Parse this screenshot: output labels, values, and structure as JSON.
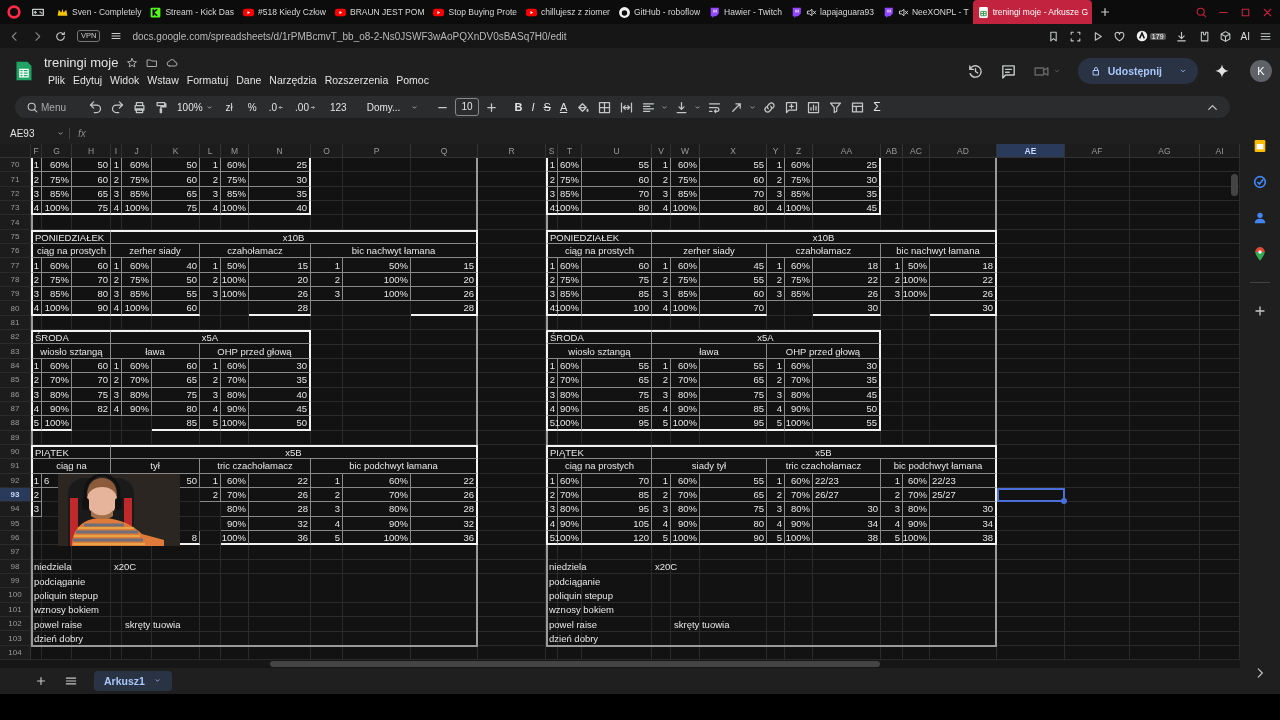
{
  "browser": {
    "tabs": [
      {
        "kind": "crown",
        "title": "Sven - Completely",
        "muted": false,
        "selected": false
      },
      {
        "kind": "kick",
        "title": "Stream - Kick Das",
        "muted": false,
        "selected": false
      },
      {
        "kind": "video",
        "title": "#518 Kiedy Człow",
        "muted": false,
        "selected": false
      },
      {
        "kind": "video",
        "title": "BRAUN JEST POM",
        "muted": false,
        "selected": false
      },
      {
        "kind": "video",
        "title": "Stop Buying Prote",
        "muted": false,
        "selected": false
      },
      {
        "kind": "video",
        "title": "chillujesz z ziomer",
        "muted": false,
        "selected": false
      },
      {
        "kind": "github",
        "title": "GitHub - roboflow",
        "muted": false,
        "selected": false
      },
      {
        "kind": "twitch",
        "title": "Hawier - Twitch",
        "muted": false,
        "selected": false
      },
      {
        "kind": "twitch",
        "title": "lapajaguara93",
        "muted": true,
        "selected": false
      },
      {
        "kind": "twitch",
        "title": "NeeXONPL - T",
        "muted": true,
        "selected": false
      },
      {
        "kind": "sheets",
        "title": "treningi moje - Arkusze G",
        "muted": false,
        "selected": true
      }
    ],
    "vpn_badge": "VPN",
    "url": "docs.google.com/spreadsheets/d/1rPMBcmvT_bb_o8-2-Ns0JSWF3wAoPQXnDV0sBASq7H0/edit",
    "extension_badge": "179",
    "ai_label": "AI"
  },
  "docs": {
    "title": "treningi moje",
    "menu": [
      "Plik",
      "Edytuj",
      "Widok",
      "Wstaw",
      "Formatuj",
      "Dane",
      "Narzędzia",
      "Rozszerzenia",
      "Pomoc"
    ],
    "share": "Udostępnij",
    "avatar": "K"
  },
  "toolbar": [
    {
      "kind": "search",
      "label": "Menu"
    },
    {
      "kind": "undo"
    },
    {
      "kind": "redo"
    },
    {
      "kind": "print"
    },
    {
      "kind": "paint-format"
    },
    {
      "kind": "zoom",
      "label": "100%"
    },
    {
      "kind": "text",
      "label": "zł"
    },
    {
      "kind": "text",
      "label": "%"
    },
    {
      "kind": "decimals-less",
      "label": ".0"
    },
    {
      "kind": "decimals-more",
      "label": ".00"
    },
    {
      "kind": "text",
      "label": "123"
    },
    {
      "kind": "font",
      "label": "Domy..."
    },
    {
      "kind": "minus"
    },
    {
      "kind": "size",
      "label": "10"
    },
    {
      "kind": "plus"
    },
    {
      "kind": "bold",
      "label": "B"
    },
    {
      "kind": "italic",
      "label": "I"
    },
    {
      "kind": "strike",
      "label": "S"
    },
    {
      "kind": "text-color",
      "label": "A"
    },
    {
      "kind": "fill"
    },
    {
      "kind": "borders"
    },
    {
      "kind": "merge"
    },
    {
      "kind": "align"
    },
    {
      "kind": "valign"
    },
    {
      "kind": "wrap"
    },
    {
      "kind": "rotate"
    },
    {
      "kind": "link"
    },
    {
      "kind": "comment"
    },
    {
      "kind": "chart"
    },
    {
      "kind": "filter"
    },
    {
      "kind": "views"
    },
    {
      "kind": "sigma",
      "label": "Σ"
    },
    {
      "kind": "collapse"
    }
  ],
  "formula_bar": {
    "cell": "AE93",
    "fx": "fx"
  },
  "sheet": {
    "columns": [
      {
        "label": "F",
        "selected": false
      },
      {
        "label": "G",
        "selected": false
      },
      {
        "label": "H",
        "selected": false
      },
      {
        "label": "I",
        "selected": false
      },
      {
        "label": "J",
        "selected": false
      },
      {
        "label": "K",
        "selected": false
      },
      {
        "label": "L",
        "selected": false
      },
      {
        "label": "M",
        "selected": false
      },
      {
        "label": "N",
        "selected": false
      },
      {
        "label": "O",
        "selected": false
      },
      {
        "label": "P",
        "selected": false
      },
      {
        "label": "Q",
        "selected": false
      },
      {
        "label": "R",
        "selected": false
      },
      {
        "label": "S",
        "selected": false
      },
      {
        "label": "T",
        "selected": false
      },
      {
        "label": "U",
        "selected": false
      },
      {
        "label": "V",
        "selected": false
      },
      {
        "label": "W",
        "selected": false
      },
      {
        "label": "X",
        "selected": false
      },
      {
        "label": "Y",
        "selected": false
      },
      {
        "label": "Z",
        "selected": false
      },
      {
        "label": "AA",
        "selected": false
      },
      {
        "label": "AB",
        "selected": false
      },
      {
        "label": "AC",
        "selected": false
      },
      {
        "label": "AD",
        "selected": false
      },
      {
        "label": "AE",
        "selected": true
      },
      {
        "label": "AF",
        "selected": false
      },
      {
        "label": "AG",
        "selected": false
      },
      {
        "label": "AI",
        "selected": false
      }
    ],
    "rows": [
      {
        "label": "70",
        "selected": false
      },
      {
        "label": "71",
        "selected": false
      },
      {
        "label": "72",
        "selected": false
      },
      {
        "label": "73",
        "selected": false
      },
      {
        "label": "74",
        "selected": false
      },
      {
        "label": "75",
        "selected": false
      },
      {
        "label": "76",
        "selected": false
      },
      {
        "label": "77",
        "selected": false
      },
      {
        "label": "78",
        "selected": false
      },
      {
        "label": "79",
        "selected": false
      },
      {
        "label": "80",
        "selected": false
      },
      {
        "label": "81",
        "selected": false
      },
      {
        "label": "82",
        "selected": false
      },
      {
        "label": "83",
        "selected": false
      },
      {
        "label": "84",
        "selected": false
      },
      {
        "label": "85",
        "selected": false
      },
      {
        "label": "86",
        "selected": false
      },
      {
        "label": "87",
        "selected": false
      },
      {
        "label": "88",
        "selected": false
      },
      {
        "label": "89",
        "selected": false
      },
      {
        "label": "90",
        "selected": false
      },
      {
        "label": "91",
        "selected": false
      },
      {
        "label": "92",
        "selected": false
      },
      {
        "label": "93",
        "selected": true
      },
      {
        "label": "94",
        "selected": false
      },
      {
        "label": "95",
        "selected": false
      },
      {
        "label": "96",
        "selected": false
      },
      {
        "label": "97",
        "selected": false
      },
      {
        "label": "98",
        "selected": false
      },
      {
        "label": "99",
        "selected": false
      },
      {
        "label": "100",
        "selected": false
      },
      {
        "label": "101",
        "selected": false
      },
      {
        "label": "102",
        "selected": false
      },
      {
        "label": "103",
        "selected": false
      },
      {
        "label": "104",
        "selected": false
      }
    ],
    "weeks": [
      {
        "blocks": [
          {
            "exercises": [
              {
                "sets": [
                  {
                    "n": "1",
                    "pct": "60%",
                    "load": "50"
                  },
                  {
                    "n": "2",
                    "pct": "75%",
                    "load": "60"
                  },
                  {
                    "n": "3",
                    "pct": "85%",
                    "load": "65"
                  },
                  {
                    "n": "4",
                    "pct": "100%",
                    "load": "75"
                  }
                ]
              },
              {
                "sets": [
                  {
                    "n": "1",
                    "pct": "60%",
                    "load": "50"
                  },
                  {
                    "n": "2",
                    "pct": "75%",
                    "load": "60"
                  },
                  {
                    "n": "3",
                    "pct": "85%",
                    "load": "65"
                  },
                  {
                    "n": "4",
                    "pct": "100%",
                    "load": "75"
                  }
                ]
              },
              {
                "sets": [
                  {
                    "n": "1",
                    "pct": "60%",
                    "load": "25"
                  },
                  {
                    "n": "2",
                    "pct": "75%",
                    "load": "30"
                  },
                  {
                    "n": "3",
                    "pct": "85%",
                    "load": "35"
                  },
                  {
                    "n": "4",
                    "pct": "100%",
                    "load": "40"
                  }
                ]
              }
            ]
          },
          {
            "title": "PONIEDZIAŁEK",
            "label": "x10B",
            "exercises": [
              {
                "name": "ciąg na prostych",
                "sets": [
                  {
                    "n": "1",
                    "pct": "60%",
                    "load": "60"
                  },
                  {
                    "n": "2",
                    "pct": "75%",
                    "load": "70"
                  },
                  {
                    "n": "3",
                    "pct": "85%",
                    "load": "80"
                  },
                  {
                    "n": "4",
                    "pct": "100%",
                    "load": "90"
                  }
                ]
              },
              {
                "name": "zerher siady",
                "sets": [
                  {
                    "n": "1",
                    "pct": "60%",
                    "load": "40"
                  },
                  {
                    "n": "2",
                    "pct": "75%",
                    "load": "50"
                  },
                  {
                    "n": "3",
                    "pct": "85%",
                    "load": "55"
                  },
                  {
                    "n": "4",
                    "pct": "100%",
                    "load": "60"
                  }
                ]
              },
              {
                "name": "czahołamacz",
                "sets": [
                  {
                    "n": "1",
                    "pct": "50%",
                    "load": "15"
                  },
                  {
                    "n": "2",
                    "pct": "100%",
                    "load": "20"
                  },
                  {
                    "n": "3",
                    "pct": "100%",
                    "load": "26"
                  },
                  {
                    "load": "28"
                  }
                ]
              },
              {
                "name": "bic nachwyt łamana",
                "sets": [
                  {
                    "n": "1",
                    "pct": "50%",
                    "load": "15"
                  },
                  {
                    "n": "2",
                    "pct": "100%",
                    "load": "20"
                  },
                  {
                    "n": "3",
                    "pct": "100%",
                    "load": "26"
                  },
                  {
                    "load": "28"
                  }
                ]
              }
            ]
          },
          {
            "title": "ŚRODA",
            "label": "x5A",
            "exercises": [
              {
                "name": "wiosło sztangą",
                "sets": [
                  {
                    "n": "1",
                    "pct": "60%",
                    "load": "60"
                  },
                  {
                    "n": "2",
                    "pct": "70%",
                    "load": "70"
                  },
                  {
                    "n": "3",
                    "pct": "80%",
                    "load": "75"
                  },
                  {
                    "n": "4",
                    "pct": "90%",
                    "load": "82"
                  },
                  {
                    "n": "5",
                    "pct": "100%"
                  }
                ]
              },
              {
                "name": "ława",
                "sets": [
                  {
                    "n": "1",
                    "pct": "60%",
                    "load": "60"
                  },
                  {
                    "n": "2",
                    "pct": "70%",
                    "load": "65"
                  },
                  {
                    "n": "3",
                    "pct": "80%",
                    "load": "75"
                  },
                  {
                    "n": "4",
                    "pct": "90%",
                    "load": "80"
                  },
                  {
                    "load": "85"
                  }
                ]
              },
              {
                "name": "OHP przed głową",
                "sets": [
                  {
                    "n": "1",
                    "pct": "60%",
                    "load": "30"
                  },
                  {
                    "n": "2",
                    "pct": "70%",
                    "load": "35"
                  },
                  {
                    "n": "3",
                    "pct": "80%",
                    "load": "40"
                  },
                  {
                    "n": "4",
                    "pct": "90%",
                    "load": "45"
                  },
                  {
                    "n": "5",
                    "pct": "100%",
                    "load": "50"
                  }
                ]
              }
            ]
          },
          {
            "title": "PIĄTEK",
            "label": "x5B",
            "exercises": [
              {
                "name": "ciąg na",
                "sets": [
                  {
                    "n": "1",
                    "pct": "6",
                    "pct_text": true
                  },
                  {
                    "n": "2"
                  },
                  {
                    "n": "3"
                  },
                  {
                    "covered": true
                  },
                  {
                    "covered": true
                  }
                ]
              },
              {
                "name": "tył",
                "sets": [
                  {
                    "load": "50"
                  },
                  {
                    "covered": true
                  },
                  {
                    "covered": true
                  },
                  {
                    "covered": true
                  },
                  {
                    "load": "8"
                  }
                ]
              },
              {
                "name": "tric czachołamacz",
                "sets": [
                  {
                    "n": "1",
                    "pct": "60%",
                    "load": "22"
                  },
                  {
                    "n": "2",
                    "pct": "70%",
                    "load": "26"
                  },
                  {
                    "pct": "80%",
                    "load": "28"
                  },
                  {
                    "pct": "90%",
                    "load": "32"
                  },
                  {
                    "pct": "100%",
                    "load": "36"
                  }
                ]
              },
              {
                "name": "bic podchwyt łamana",
                "sets": [
                  {
                    "n": "1",
                    "pct": "60%",
                    "load": "22"
                  },
                  {
                    "n": "2",
                    "pct": "70%",
                    "load": "26"
                  },
                  {
                    "n": "3",
                    "pct": "80%",
                    "load": "28"
                  },
                  {
                    "n": "4",
                    "pct": "90%",
                    "load": "32"
                  },
                  {
                    "n": "5",
                    "pct": "100%",
                    "load": "36"
                  }
                ]
              }
            ]
          }
        ],
        "notes": [
          {
            "label": "niedziela",
            "extras": [
              {
                "kind": "tag",
                "text": "x20C"
              }
            ]
          },
          {
            "label": "podciąganie"
          },
          {
            "label": "poliquin stepup"
          },
          {
            "label": "wznosy bokiem"
          },
          {
            "label": "powel raise",
            "extras": [
              {
                "kind": "remark",
                "text": "skręty tuowia"
              }
            ]
          },
          {
            "label": "dzień dobry"
          }
        ]
      },
      {
        "blocks": [
          {
            "exercises": [
              {
                "sets": [
                  {
                    "n": "1",
                    "pct": "60%",
                    "load": "55"
                  },
                  {
                    "n": "2",
                    "pct": "75%",
                    "load": "60"
                  },
                  {
                    "n": "3",
                    "pct": "85%",
                    "load": "70"
                  },
                  {
                    "n": "4",
                    "pct": "100%",
                    "load": "80"
                  }
                ]
              },
              {
                "sets": [
                  {
                    "n": "1",
                    "pct": "60%",
                    "load": "55"
                  },
                  {
                    "n": "2",
                    "pct": "75%",
                    "load": "60"
                  },
                  {
                    "n": "3",
                    "pct": "85%",
                    "load": "70"
                  },
                  {
                    "n": "4",
                    "pct": "100%",
                    "load": "80"
                  }
                ]
              },
              {
                "sets": [
                  {
                    "n": "1",
                    "pct": "60%",
                    "load": "25"
                  },
                  {
                    "n": "2",
                    "pct": "75%",
                    "load": "30"
                  },
                  {
                    "n": "3",
                    "pct": "85%",
                    "load": "35"
                  },
                  {
                    "n": "4",
                    "pct": "100%",
                    "load": "45"
                  }
                ]
              }
            ]
          },
          {
            "title": "PONIEDZIAŁEK",
            "label": "x10B",
            "exercises": [
              {
                "name": "ciąg na prostych",
                "sets": [
                  {
                    "n": "1",
                    "pct": "60%",
                    "load": "60"
                  },
                  {
                    "n": "2",
                    "pct": "75%",
                    "load": "75"
                  },
                  {
                    "n": "3",
                    "pct": "85%",
                    "load": "85"
                  },
                  {
                    "n": "4",
                    "pct": "100%",
                    "load": "100"
                  }
                ]
              },
              {
                "name": "zerher siady",
                "sets": [
                  {
                    "n": "1",
                    "pct": "60%",
                    "load": "45"
                  },
                  {
                    "n": "2",
                    "pct": "75%",
                    "load": "55"
                  },
                  {
                    "n": "3",
                    "pct": "85%",
                    "load": "60"
                  },
                  {
                    "n": "4",
                    "pct": "100%",
                    "load": "70"
                  }
                ]
              },
              {
                "name": "czahołamacz",
                "sets": [
                  {
                    "n": "1",
                    "pct": "60%",
                    "load": "18"
                  },
                  {
                    "n": "2",
                    "pct": "75%",
                    "load": "22"
                  },
                  {
                    "n": "3",
                    "pct": "85%",
                    "load": "26"
                  },
                  {
                    "load": "30"
                  }
                ]
              },
              {
                "name": "bic nachwyt łamana",
                "sets": [
                  {
                    "n": "1",
                    "pct": "50%",
                    "load": "18"
                  },
                  {
                    "n": "2",
                    "pct": "100%",
                    "load": "22"
                  },
                  {
                    "n": "3",
                    "pct": "100%",
                    "load": "26"
                  },
                  {
                    "load": "30"
                  }
                ]
              }
            ]
          },
          {
            "title": "ŚRODA",
            "label": "x5A",
            "exercises": [
              {
                "name": "wiosło sztangą",
                "sets": [
                  {
                    "n": "1",
                    "pct": "60%",
                    "load": "55"
                  },
                  {
                    "n": "2",
                    "pct": "70%",
                    "load": "65"
                  },
                  {
                    "n": "3",
                    "pct": "80%",
                    "load": "75"
                  },
                  {
                    "n": "4",
                    "pct": "90%",
                    "load": "85"
                  },
                  {
                    "n": "5",
                    "pct": "100%",
                    "load": "95"
                  }
                ]
              },
              {
                "name": "ława",
                "sets": [
                  {
                    "n": "1",
                    "pct": "60%",
                    "load": "55"
                  },
                  {
                    "n": "2",
                    "pct": "70%",
                    "load": "65"
                  },
                  {
                    "n": "3",
                    "pct": "80%",
                    "load": "75"
                  },
                  {
                    "n": "4",
                    "pct": "90%",
                    "load": "85"
                  },
                  {
                    "n": "5",
                    "pct": "100%",
                    "load": "95"
                  }
                ]
              },
              {
                "name": "OHP przed głową",
                "sets": [
                  {
                    "n": "1",
                    "pct": "60%",
                    "load": "30"
                  },
                  {
                    "n": "2",
                    "pct": "70%",
                    "load": "35"
                  },
                  {
                    "n": "3",
                    "pct": "80%",
                    "load": "45"
                  },
                  {
                    "n": "4",
                    "pct": "90%",
                    "load": "50"
                  },
                  {
                    "n": "5",
                    "pct": "100%",
                    "load": "55"
                  }
                ]
              }
            ]
          },
          {
            "title": "PIĄTEK",
            "label": "x5B",
            "exercises": [
              {
                "name": "ciąg na prostych",
                "sets": [
                  {
                    "n": "1",
                    "pct": "60%",
                    "load": "70"
                  },
                  {
                    "n": "2",
                    "pct": "70%",
                    "load": "85"
                  },
                  {
                    "n": "3",
                    "pct": "80%",
                    "load": "95"
                  },
                  {
                    "n": "4",
                    "pct": "90%",
                    "load": "105"
                  },
                  {
                    "n": "5",
                    "pct": "100%",
                    "load": "120"
                  }
                ]
              },
              {
                "name": "siady tył",
                "sets": [
                  {
                    "n": "1",
                    "pct": "60%",
                    "load": "55"
                  },
                  {
                    "n": "2",
                    "pct": "70%",
                    "load": "65"
                  },
                  {
                    "n": "3",
                    "pct": "80%",
                    "load": "75"
                  },
                  {
                    "n": "4",
                    "pct": "90%",
                    "load": "80"
                  },
                  {
                    "n": "5",
                    "pct": "100%",
                    "load": "90"
                  }
                ]
              },
              {
                "name": "tric czachołamacz",
                "sets": [
                  {
                    "n": "1",
                    "pct": "60%",
                    "load": "22/23",
                    "load_text": true
                  },
                  {
                    "n": "2",
                    "pct": "70%",
                    "load": "26/27",
                    "load_text": true
                  },
                  {
                    "n": "3",
                    "pct": "80%",
                    "load": "30"
                  },
                  {
                    "n": "4",
                    "pct": "90%",
                    "load": "34"
                  },
                  {
                    "n": "5",
                    "pct": "100%",
                    "load": "38"
                  }
                ]
              },
              {
                "name": "bic podchwyt łamana",
                "sets": [
                  {
                    "n": "1",
                    "pct": "60%",
                    "load": "22/23",
                    "load_text": true
                  },
                  {
                    "n": "2",
                    "pct": "70%",
                    "load": "25/27",
                    "load_text": true
                  },
                  {
                    "n": "3",
                    "pct": "80%",
                    "load": "30"
                  },
                  {
                    "n": "4",
                    "pct": "90%",
                    "load": "34"
                  },
                  {
                    "n": "5",
                    "pct": "100%",
                    "load": "38"
                  }
                ]
              }
            ]
          }
        ],
        "notes": [
          {
            "label": "niedziela",
            "extras": [
              {
                "kind": "tag",
                "text": "x20C"
              }
            ]
          },
          {
            "label": "podciąganie"
          },
          {
            "label": "poliquin stepup"
          },
          {
            "label": "wznosy bokiem"
          },
          {
            "label": "powel raise",
            "extras": [
              {
                "kind": "remark",
                "text": "skręty tuowia"
              }
            ]
          },
          {
            "label": "dzień dobry"
          }
        ]
      }
    ]
  },
  "sheet_tabs": [
    {
      "name": "Arkusz1",
      "selected": true
    }
  ]
}
